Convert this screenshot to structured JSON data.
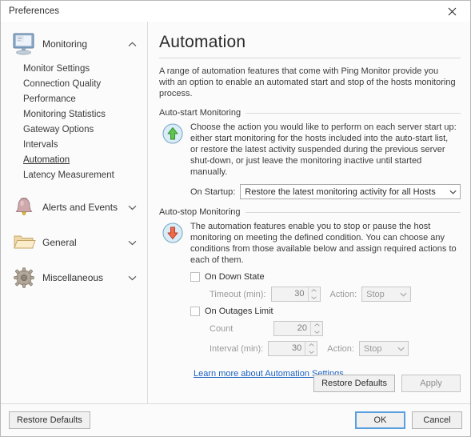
{
  "window": {
    "title": "Preferences",
    "close_icon": "close-icon"
  },
  "sidebar": {
    "categories": [
      {
        "label": "Monitoring",
        "icon": "monitor-icon",
        "chevron": "chevron-up-icon",
        "expanded": true,
        "items": [
          "Monitor Settings",
          "Connection Quality",
          "Performance",
          "Monitoring Statistics",
          "Gateway Options",
          "Intervals",
          "Automation",
          "Latency Measurement"
        ],
        "selected_item": "Automation"
      },
      {
        "label": "Alerts and Events",
        "icon": "bell-icon",
        "chevron": "chevron-down-icon",
        "expanded": false,
        "items": []
      },
      {
        "label": "General",
        "icon": "folder-icon",
        "chevron": "chevron-down-icon",
        "expanded": false,
        "items": []
      },
      {
        "label": "Miscellaneous",
        "icon": "gear-icon",
        "chevron": "chevron-down-icon",
        "expanded": false,
        "items": []
      }
    ]
  },
  "main": {
    "title": "Automation",
    "intro": "A range of automation features that come with Ping Monitor provide you with an option to enable an automated start and stop of the hosts monitoring process.",
    "autostart": {
      "group_title": "Auto-start Monitoring",
      "icon": "green-up-arrow-icon",
      "description": "Choose the action you would like to perform on each server start up: either start monitoring for the hosts included into the auto-start list, or restore the latest activity suspended during the previous server shut-down, or just leave the monitoring inactive until started manually.",
      "startup_label": "On Startup:",
      "startup_value": "Restore the latest monitoring activity for all Hosts",
      "dropdown_icon": "chevron-down-icon"
    },
    "autostop": {
      "group_title": "Auto-stop Monitoring",
      "icon": "red-down-arrow-icon",
      "description": "The automation features enable you to stop or pause the host monitoring on meeting the defined condition. You can choose any conditions from those available below and assign required actions to each of them.",
      "on_down_state": {
        "checkbox_label": "On Down State",
        "checked": false,
        "timeout_label": "Timeout (min):",
        "timeout_value": "30",
        "action_label": "Action:",
        "action_value": "Stop"
      },
      "on_outages_limit": {
        "checkbox_label": "On Outages Limit",
        "checked": false,
        "count_label": "Count",
        "count_value": "20",
        "interval_label": "Interval (min):",
        "interval_value": "30",
        "action_label": "Action:",
        "action_value": "Stop"
      },
      "learn_more": "Learn more about Automation Settings"
    },
    "actions": {
      "restore_defaults": "Restore Defaults",
      "apply": "Apply",
      "apply_disabled": true
    }
  },
  "footer": {
    "restore_defaults": "Restore Defaults",
    "ok": "OK",
    "cancel": "Cancel"
  },
  "colors": {
    "link": "#1d62c2",
    "focus_border": "#5a9fe0",
    "up_arrow": "#3fa535",
    "down_arrow": "#e2553c"
  }
}
